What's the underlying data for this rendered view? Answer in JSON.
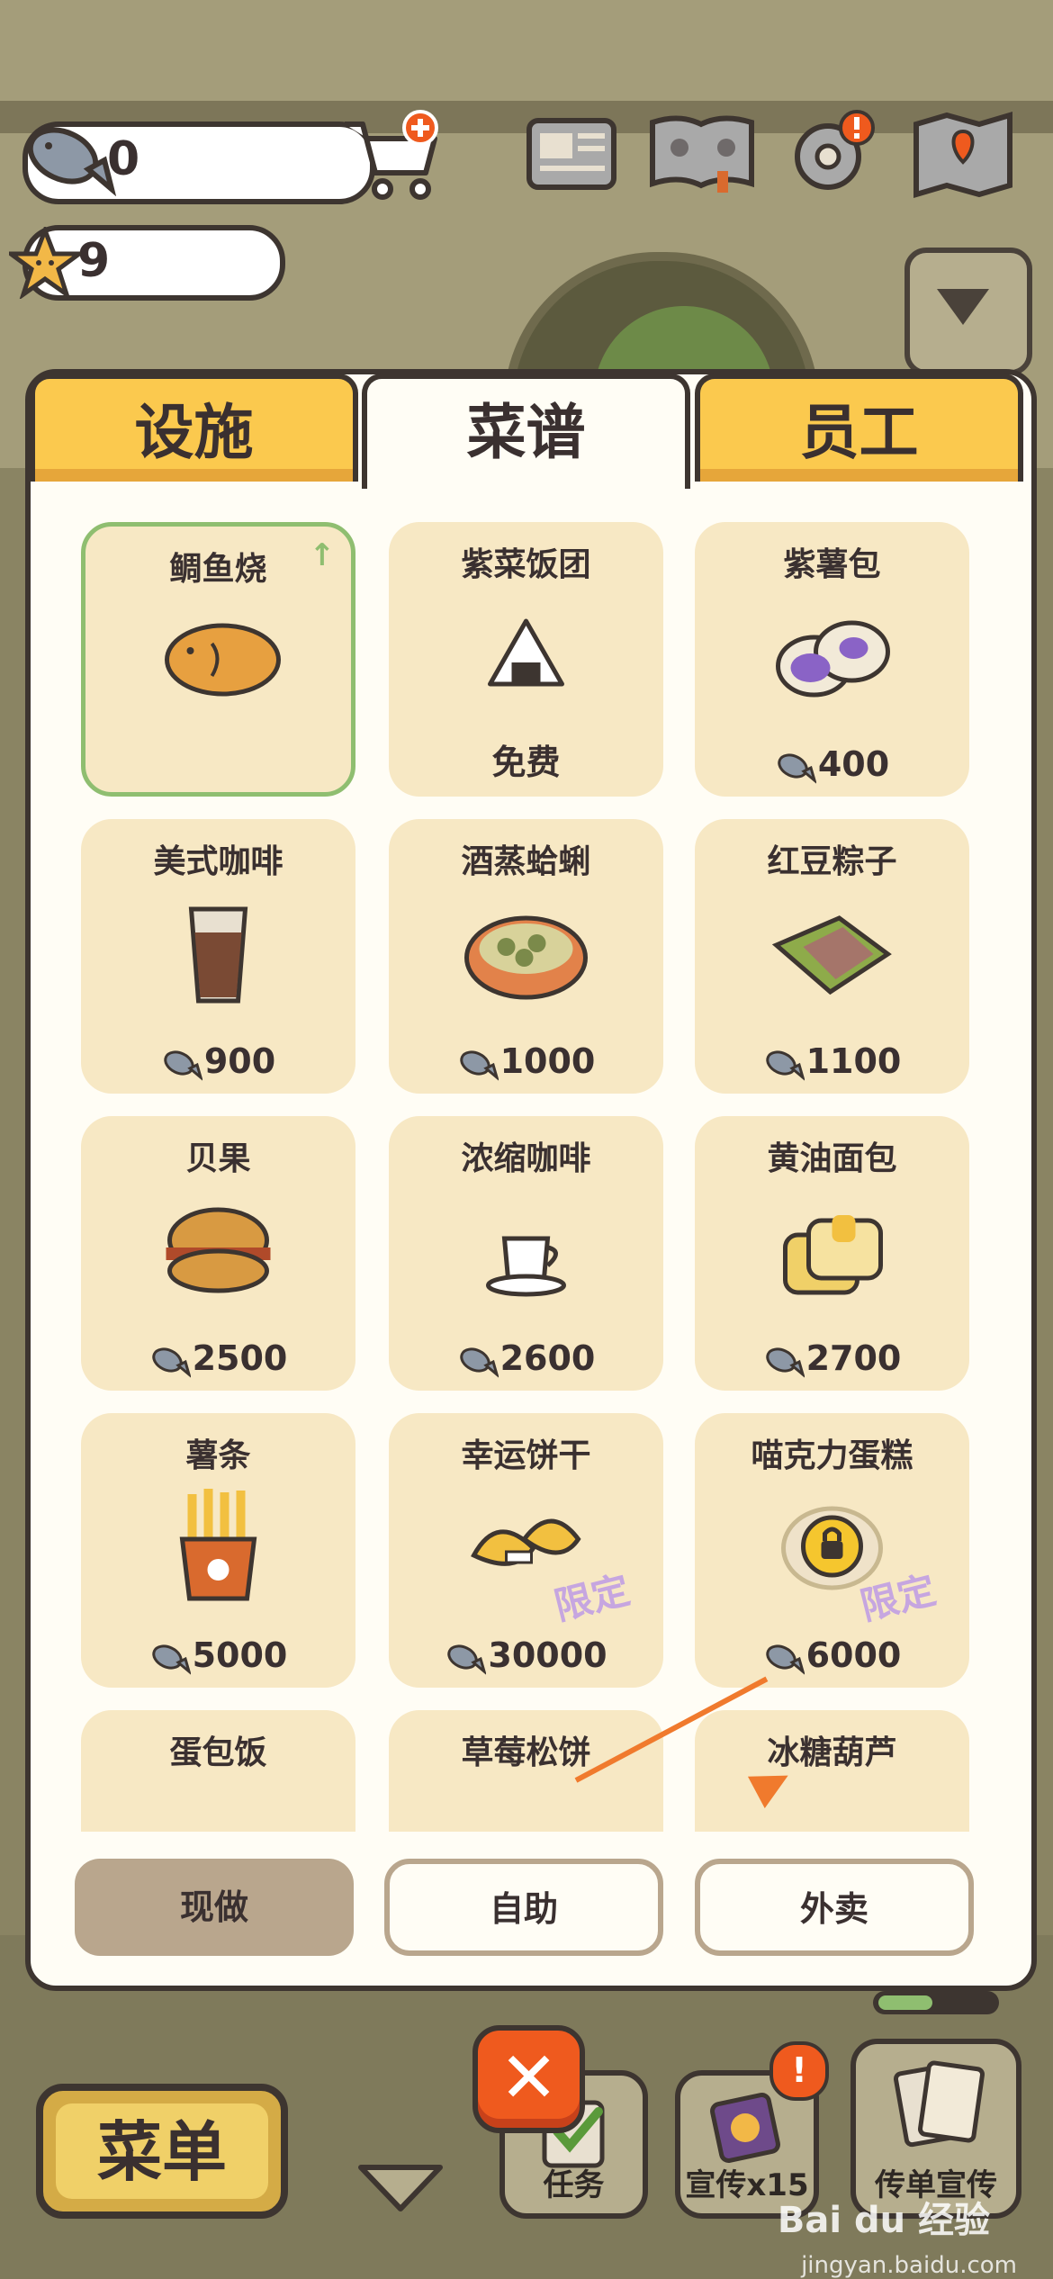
{
  "hud": {
    "fish_count": "0",
    "star_count": "9"
  },
  "tabs": [
    {
      "label": "设施",
      "active": false
    },
    {
      "label": "菜谱",
      "active": true
    },
    {
      "label": "员工",
      "active": false
    }
  ],
  "recipes": [
    {
      "name": "鲷鱼烧",
      "price": "",
      "selected": true,
      "art": "taiyaki"
    },
    {
      "name": "紫菜饭团",
      "price": "免费",
      "free": true,
      "art": "onigiri"
    },
    {
      "name": "紫薯包",
      "price": "400",
      "art": "purple-bun"
    },
    {
      "name": "美式咖啡",
      "price": "900",
      "art": "iced-coffee"
    },
    {
      "name": "酒蒸蛤蜊",
      "price": "1000",
      "art": "clams"
    },
    {
      "name": "红豆粽子",
      "price": "1100",
      "art": "zongzi"
    },
    {
      "name": "贝果",
      "price": "2500",
      "art": "bagel"
    },
    {
      "name": "浓缩咖啡",
      "price": "2600",
      "art": "espresso"
    },
    {
      "name": "黄油面包",
      "price": "2700",
      "art": "butter-toast"
    },
    {
      "name": "薯条",
      "price": "5000",
      "art": "fries"
    },
    {
      "name": "幸运饼干",
      "price": "30000",
      "limited": "限定",
      "art": "fortune-cookie"
    },
    {
      "name": "喵克力蛋糕",
      "price": "6000",
      "limited": "限定",
      "locked": true,
      "art": "locked-cake"
    },
    {
      "name": "蛋包饭",
      "price": "",
      "art": "omurice"
    },
    {
      "name": "草莓松饼",
      "price": "",
      "art": "pancake"
    },
    {
      "name": "冰糖葫芦",
      "price": "",
      "art": "tanghulu"
    }
  ],
  "modes": [
    {
      "label": "现做",
      "active": true
    },
    {
      "label": "自助",
      "active": false
    },
    {
      "label": "外卖",
      "active": false
    }
  ],
  "bottom_bar": {
    "menu_label": "菜单",
    "task_label": "任务",
    "promo_label": "宣传x15",
    "flyer_label": "传单宣传",
    "badge": "!"
  },
  "watermark": {
    "brand": "Bai du 经验",
    "url": "jingyan.baidu.com"
  },
  "colors": {
    "tab_yellow": "#fbc94e",
    "card_bg": "#f7e8c4",
    "selected_border": "#8fbe70",
    "close_red": "#ef5a1e",
    "annotation_arrow": "#f07a2d"
  }
}
